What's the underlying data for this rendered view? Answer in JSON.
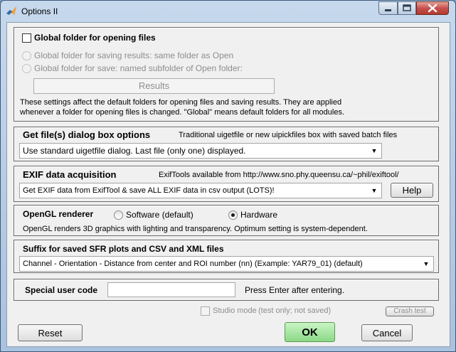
{
  "window": {
    "title": "Options II"
  },
  "global_folder": {
    "open_label": "Global folder for opening files",
    "save_same_label": "Global folder for saving results: same folder as Open",
    "save_named_label": "Global folder for save: named subfolder of Open folder:",
    "subfolder_value": "Results",
    "note_line1": "These settings affect the default folders for opening files and saving results. They are applied",
    "note_line2": "whenever a folder for opening files is changed. \"Global\" means default folders for all modules."
  },
  "get_files": {
    "heading": "Get file(s) dialog box options",
    "description": "Traditional uigetfile or new uipickfiles box with saved batch files",
    "selected": "Use standard uigetfile dialog.  Last file (only one) displayed."
  },
  "exif": {
    "heading": "EXIF data acquisition",
    "description": "ExifTools available from http://www.sno.phy.queensu.ca/~phil/exiftool/",
    "selected": "Get EXIF data from ExifTool & save ALL EXIF data in csv output (LOTS)!",
    "help_label": "Help"
  },
  "opengl": {
    "heading": "OpenGL renderer",
    "software_label": "Software (default)",
    "hardware_label": "Hardware",
    "selected": "Hardware",
    "note": "OpenGL renders 3D graphics with lighting and transparency. Optimum setting is system-dependent."
  },
  "suffix": {
    "heading": "Suffix for saved SFR plots and CSV and XML files",
    "selected": "Channel - Orientation - Distance from center and ROI number (nn)  (Example:  YAR79_01)  (default)"
  },
  "user_code": {
    "label": "Special user code",
    "value": "",
    "hint": "Press Enter after entering."
  },
  "studio_mode": {
    "label": "Studio mode",
    "note": "(test only; not saved)",
    "crash_label": "Crash test"
  },
  "footer": {
    "reset_label": "Reset",
    "ok_label": "OK",
    "cancel_label": "Cancel"
  },
  "colors": {
    "ok_button": "#9ee59a",
    "window_frame": "#a9c2de"
  },
  "icons": {
    "app": "matlab-logo-icon",
    "minimize": "minimize-icon",
    "maximize": "maximize-icon",
    "close": "close-icon",
    "dropdown": "chevron-down-icon"
  }
}
